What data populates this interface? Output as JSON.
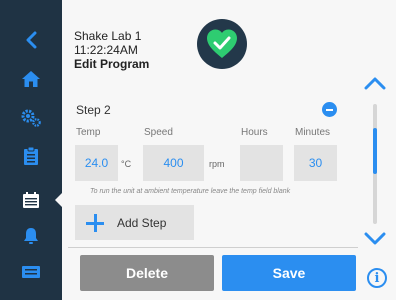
{
  "header": {
    "device_name": "Shake Lab 1",
    "time": "11:22:24AM",
    "screen_title": "Edit Program"
  },
  "sidebar": {
    "items": [
      {
        "icon": "back-chevron-icon"
      },
      {
        "icon": "home-icon"
      },
      {
        "icon": "settings-gears-icon"
      },
      {
        "icon": "clipboard-icon"
      },
      {
        "icon": "programs-calendar-icon",
        "active": true
      },
      {
        "icon": "bell-alarm-icon"
      },
      {
        "icon": "screen-display-icon"
      }
    ]
  },
  "step": {
    "title": "Step 2",
    "fields": {
      "temp_label": "Temp",
      "speed_label": "Speed",
      "hours_label": "Hours",
      "minutes_label": "Minutes",
      "temp_value": "24.0",
      "temp_unit": "°C",
      "speed_value": "400",
      "speed_unit": "rpm",
      "hours_value": "",
      "minutes_value": "30"
    },
    "hint": "To run the unit at ambient temperature leave the temp field blank"
  },
  "add_step_label": "Add Step",
  "actions": {
    "delete_label": "Delete",
    "save_label": "Save"
  },
  "colors": {
    "sidebar": "#1f3344",
    "accent": "#2b8ef0",
    "health_ok": "#2ecc71",
    "delete_button": "#8c8c8c"
  }
}
